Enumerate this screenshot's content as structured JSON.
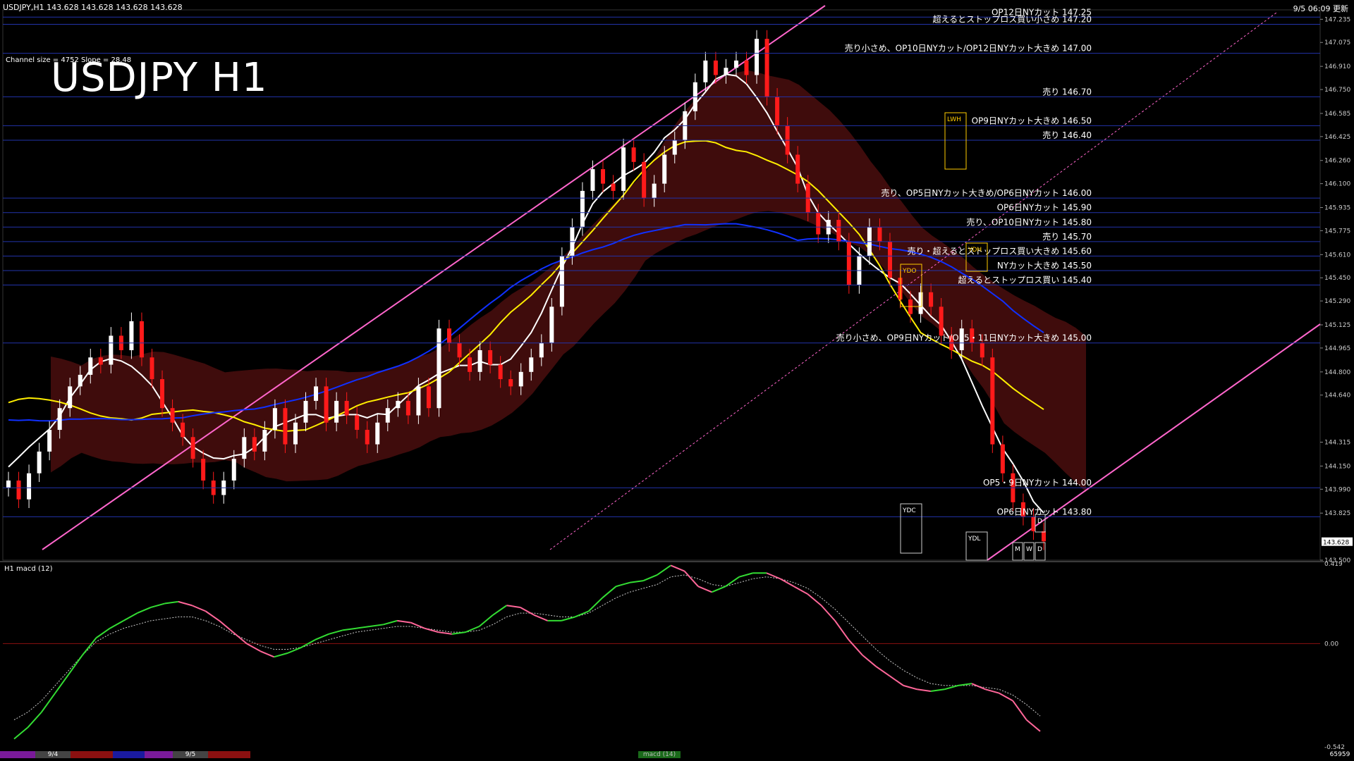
{
  "header": {
    "symbol_info": "USDJPY,H1  143.628 143.628 143.628 143.628",
    "update_time": "9/5 06:09 更新",
    "channel_info": "Channel size = 4752 Slope = 28.48"
  },
  "chart_title": "USDJPY H1",
  "colors": {
    "background": "#000000",
    "grid": "#2233aa",
    "bull_candle": "#ffffff",
    "bear_candle": "#ff1a1a",
    "cloud_bear": "#8b1a1a",
    "cloud_bull": "#1a2a9b",
    "channel": "#ff66cc",
    "ma_fast": "#ffffff",
    "ma_mid": "#ffee00",
    "ma_slow": "#1030ff",
    "macd_up": "#33dd33",
    "macd_down": "#ff6699",
    "macd_signal": "#cccccc"
  },
  "chart_data": [
    {
      "type": "candlestick",
      "title": "USDJPY H1",
      "ylim": [
        143.5,
        147.3
      ],
      "y_ticks": [
        "147.235",
        "147.075",
        "146.910",
        "146.750",
        "146.585",
        "146.425",
        "146.260",
        "146.100",
        "145.935",
        "145.775",
        "145.610",
        "145.450",
        "145.290",
        "145.125",
        "144.965",
        "144.800",
        "144.640",
        "144.315",
        "144.150",
        "143.990",
        "143.825",
        "143.500"
      ],
      "current_price": "143.628",
      "x_labels": [
        "9/4",
        "9/5"
      ],
      "levels": [
        {
          "price": 147.25,
          "label": "OP12日NYカット 147.25"
        },
        {
          "price": 147.2,
          "label": "超えるとストップロス買い小さめ 147.20"
        },
        {
          "price": 147.0,
          "label": "売り小さめ、OP10日NYカット/OP12日NYカット大きめ 147.00"
        },
        {
          "price": 146.7,
          "label": "売り 146.70"
        },
        {
          "price": 146.5,
          "label": "OP9日NYカット大きめ 146.50"
        },
        {
          "price": 146.4,
          "label": "売り 146.40"
        },
        {
          "price": 146.0,
          "label": "売り、OP5日NYカット大きめ/OP6日NYカット 146.00"
        },
        {
          "price": 145.9,
          "label": "OP6日NYカット 145.90"
        },
        {
          "price": 145.8,
          "label": "売り、OP10日NYカット 145.80"
        },
        {
          "price": 145.7,
          "label": "売り 145.70"
        },
        {
          "price": 145.6,
          "label": "売り・超えるとストップロス買い大きめ 145.60"
        },
        {
          "price": 145.5,
          "label": "NYカット大きめ 145.50"
        },
        {
          "price": 145.4,
          "label": "超えるとストップロス買い 145.40"
        },
        {
          "price": 145.0,
          "label": "売り小さめ、OP9日NYカット/OP5・11日NYカット大きめ 145.00"
        },
        {
          "price": 144.0,
          "label": "OP5・9日NYカット 144.00"
        },
        {
          "price": 143.8,
          "label": "OP6日NYカット 143.80"
        }
      ],
      "box_labels": [
        "YDO",
        "YDH",
        "LWH",
        "YDC",
        "YDL",
        "M",
        "W",
        "D",
        "D"
      ],
      "close_path": [
        144.05,
        143.92,
        144.1,
        144.25,
        144.4,
        144.55,
        144.7,
        144.78,
        144.9,
        144.85,
        145.05,
        144.95,
        145.15,
        144.9,
        144.75,
        144.55,
        144.45,
        144.35,
        144.2,
        144.05,
        143.95,
        144.05,
        144.2,
        144.35,
        144.25,
        144.4,
        144.55,
        144.3,
        144.45,
        144.6,
        144.7,
        144.45,
        144.6,
        144.5,
        144.4,
        144.3,
        144.45,
        144.55,
        144.6,
        144.5,
        144.7,
        144.55,
        145.1,
        145.0,
        144.9,
        144.8,
        144.95,
        144.85,
        144.75,
        144.7,
        144.8,
        144.9,
        145.0,
        145.25,
        145.6,
        145.8,
        146.05,
        146.2,
        146.1,
        146.05,
        146.35,
        146.25,
        146.0,
        146.1,
        146.3,
        146.4,
        146.6,
        146.8,
        146.95,
        146.85,
        146.9,
        146.95,
        146.85,
        147.1,
        146.7,
        146.5,
        146.3,
        146.1,
        145.9,
        145.75,
        145.85,
        145.7,
        145.4,
        145.6,
        145.8,
        145.7,
        145.45,
        145.3,
        145.2,
        145.35,
        145.25,
        145.05,
        144.95,
        145.1,
        145.0,
        144.9,
        144.3,
        144.1,
        143.9,
        143.8,
        143.7,
        143.63
      ]
    },
    {
      "type": "line",
      "title": "H1  macd (12)",
      "ylim": [
        -0.542,
        0.419
      ],
      "y_ticks": [
        "0.419",
        "0.00",
        "-0.542"
      ],
      "macd": [
        -0.5,
        -0.44,
        -0.36,
        -0.26,
        -0.16,
        -0.06,
        0.03,
        0.08,
        0.12,
        0.16,
        0.19,
        0.21,
        0.22,
        0.2,
        0.17,
        0.12,
        0.06,
        0.0,
        -0.04,
        -0.07,
        -0.05,
        -0.02,
        0.02,
        0.05,
        0.07,
        0.08,
        0.09,
        0.1,
        0.12,
        0.11,
        0.08,
        0.06,
        0.05,
        0.06,
        0.09,
        0.15,
        0.2,
        0.19,
        0.15,
        0.12,
        0.12,
        0.14,
        0.17,
        0.24,
        0.3,
        0.32,
        0.33,
        0.36,
        0.41,
        0.38,
        0.3,
        0.27,
        0.3,
        0.35,
        0.37,
        0.37,
        0.34,
        0.3,
        0.26,
        0.2,
        0.12,
        0.02,
        -0.06,
        -0.12,
        -0.17,
        -0.22,
        -0.24,
        -0.25,
        -0.24,
        -0.22,
        -0.21,
        -0.24,
        -0.26,
        -0.3,
        -0.4,
        -0.46
      ],
      "signal": [
        -0.4,
        -0.36,
        -0.3,
        -0.22,
        -0.14,
        -0.06,
        0.01,
        0.05,
        0.08,
        0.1,
        0.12,
        0.13,
        0.14,
        0.14,
        0.12,
        0.09,
        0.05,
        0.02,
        -0.01,
        -0.03,
        -0.03,
        -0.02,
        0.0,
        0.02,
        0.04,
        0.06,
        0.07,
        0.08,
        0.09,
        0.09,
        0.08,
        0.07,
        0.06,
        0.06,
        0.07,
        0.1,
        0.14,
        0.16,
        0.16,
        0.15,
        0.14,
        0.14,
        0.16,
        0.2,
        0.24,
        0.27,
        0.29,
        0.31,
        0.35,
        0.36,
        0.34,
        0.31,
        0.3,
        0.32,
        0.34,
        0.35,
        0.34,
        0.32,
        0.29,
        0.24,
        0.18,
        0.11,
        0.04,
        -0.03,
        -0.09,
        -0.14,
        -0.18,
        -0.21,
        -0.22,
        -0.22,
        -0.22,
        -0.23,
        -0.24,
        -0.27,
        -0.32,
        -0.38
      ]
    }
  ],
  "bottom_bar": {
    "label_a": "9/4",
    "label_b": "9/5",
    "indicator": "macd (14)",
    "right_value": "65959"
  }
}
